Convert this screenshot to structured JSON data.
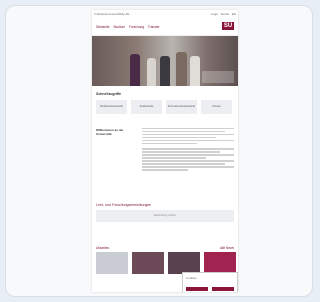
{
  "topbar": {
    "left_text": "≡ Website-Accessibility-Rc",
    "right_text": "Login · Suche · EN"
  },
  "header": {
    "nav": [
      "Startseite",
      "Studium",
      "Forschung",
      "Transfer"
    ],
    "logo": "SU"
  },
  "quicklinks": {
    "title": "Schnellzugriffe",
    "items": [
      "Studieninteressierte",
      "Studierende",
      "Promotionsinteressierte",
      "Presse"
    ]
  },
  "intro": {
    "side_heading": "Willkommen an der Universität",
    "lines": 14
  },
  "search": {
    "title": "Lehr- und Forschungseinrichtungen",
    "placeholder": "Einrichtung suchen"
  },
  "news": {
    "title": "Aktuelles",
    "more": "Alle News",
    "items": [
      "News 1",
      "News 2",
      "News 3",
      "News 4"
    ]
  },
  "cookie": {
    "text": "Cookies"
  },
  "colors": {
    "brand": "#8b1536",
    "background": "#e8eef5"
  }
}
